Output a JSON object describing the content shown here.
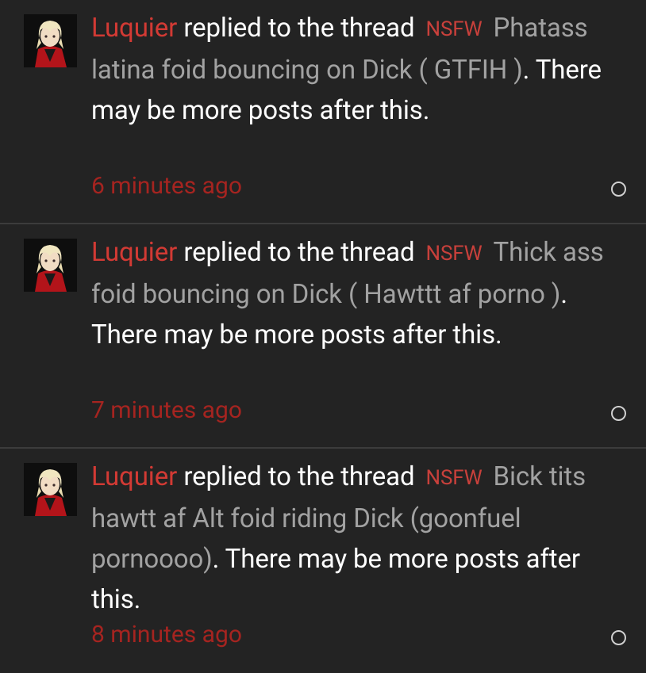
{
  "alerts": [
    {
      "username": "Luquier",
      "action_text": "replied to the thread",
      "prefix": "NSFW",
      "thread_title": "Phatass latina foid bouncing on Dick ( GTFIH )",
      "suffix_text": ". There may be more posts after this.",
      "time": "6 minutes ago",
      "avatar_icon": "anime-avatar",
      "read_indicator_icon": "circle-outline-icon"
    },
    {
      "username": "Luquier",
      "action_text": "replied to the thread",
      "prefix": "NSFW",
      "thread_title": "Thick ass foid bouncing on Dick ( Hawttt af porno )",
      "suffix_text": ". There may be more posts after this.",
      "time": "7 minutes ago",
      "avatar_icon": "anime-avatar",
      "read_indicator_icon": "circle-outline-icon"
    },
    {
      "username": "Luquier",
      "action_text": "replied to the thread",
      "prefix": "NSFW",
      "thread_title": "Bick tits hawtt af Alt foid riding Dick (goonfuel pornoooo)",
      "suffix_text": ". There may be more posts after this.",
      "time": "8 minutes ago",
      "avatar_icon": "anime-avatar",
      "read_indicator_icon": "circle-outline-icon"
    }
  ],
  "colors": {
    "background": "#232323",
    "username": "#d23a34",
    "nsfw_prefix": "#c8403b",
    "thread_title": "#a2a2a2",
    "time": "#a52420",
    "divider": "#3c3c3c"
  }
}
